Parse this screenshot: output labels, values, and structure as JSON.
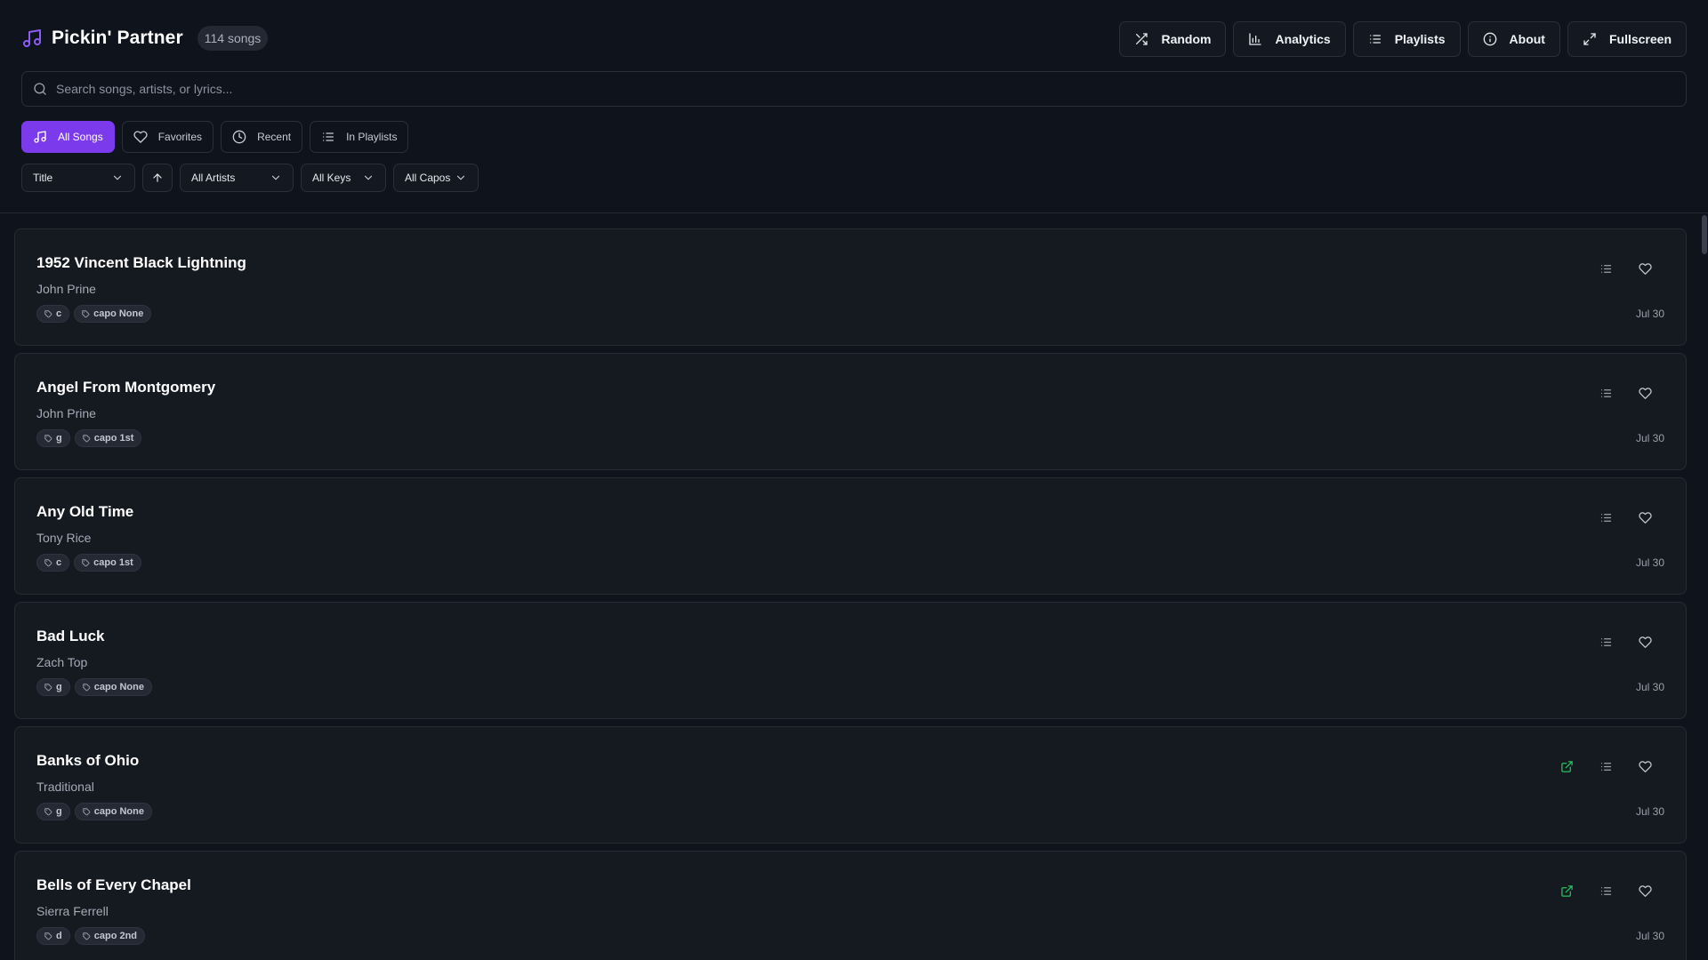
{
  "app": {
    "title": "Pickin' Partner",
    "song_count": "114 songs",
    "accent_color": "#7c3aed",
    "link_color": "#22c55e"
  },
  "header_actions": [
    {
      "label": "Random",
      "icon": "shuffle-icon"
    },
    {
      "label": "Analytics",
      "icon": "bar-chart-icon"
    },
    {
      "label": "Playlists",
      "icon": "list-icon"
    },
    {
      "label": "About",
      "icon": "info-icon"
    },
    {
      "label": "Fullscreen",
      "icon": "expand-icon"
    }
  ],
  "search": {
    "placeholder": "Search songs, artists, or lyrics...",
    "value": ""
  },
  "filter_tabs": [
    {
      "label": "All Songs",
      "icon": "music-note-icon",
      "active": true
    },
    {
      "label": "Favorites",
      "icon": "heart-icon",
      "active": false
    },
    {
      "label": "Recent",
      "icon": "clock-icon",
      "active": false
    },
    {
      "label": "In Playlists",
      "icon": "list-icon",
      "active": false
    }
  ],
  "sort": {
    "field": "Title",
    "direction": "ascending",
    "artist_filter": "All Artists",
    "key_filter": "All Keys",
    "capo_filter": "All Capos"
  },
  "songs": [
    {
      "title": "1952 Vincent Black Lightning",
      "artist": "John Prine",
      "key": "c",
      "capo": "capo None",
      "date": "Jul 30",
      "has_link": false
    },
    {
      "title": "Angel From Montgomery",
      "artist": "John Prine",
      "key": "g",
      "capo": "capo 1st",
      "date": "Jul 30",
      "has_link": false
    },
    {
      "title": "Any Old Time",
      "artist": "Tony Rice",
      "key": "c",
      "capo": "capo 1st",
      "date": "Jul 30",
      "has_link": false
    },
    {
      "title": "Bad Luck",
      "artist": "Zach Top",
      "key": "g",
      "capo": "capo None",
      "date": "Jul 30",
      "has_link": false
    },
    {
      "title": "Banks of Ohio",
      "artist": "Traditional",
      "key": "g",
      "capo": "capo None",
      "date": "Jul 30",
      "has_link": true
    },
    {
      "title": "Bells of Every Chapel",
      "artist": "Sierra Ferrell",
      "key": "d",
      "capo": "capo 2nd",
      "date": "Jul 30",
      "has_link": true
    }
  ]
}
